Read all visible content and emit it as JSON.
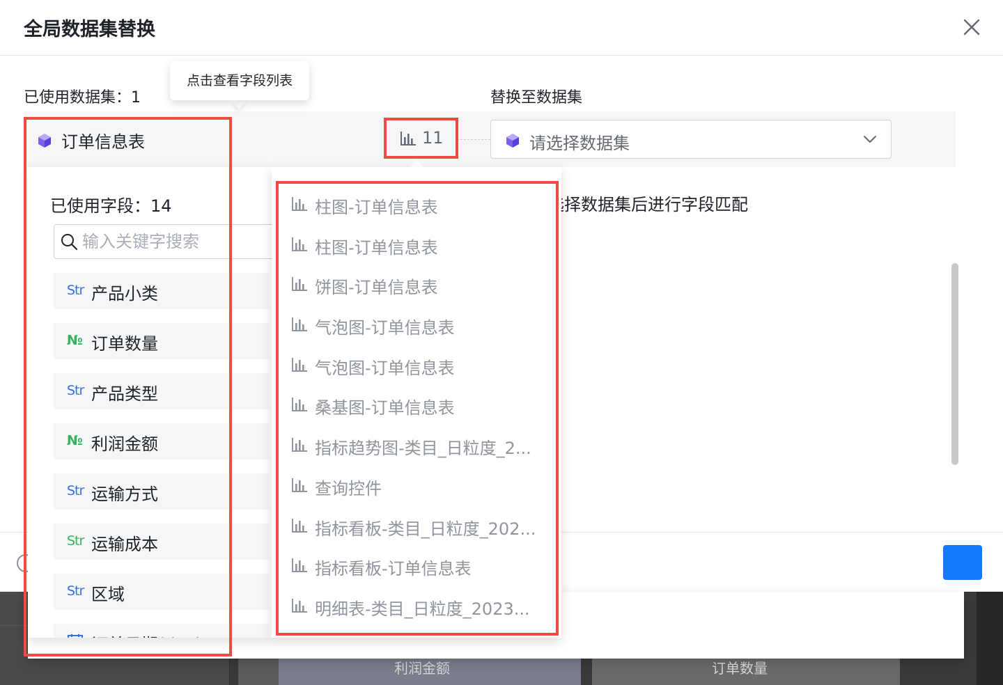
{
  "dialog": {
    "title": "全局数据集替换",
    "close_icon": "close-icon"
  },
  "left_section": {
    "label": "已使用数据集：1",
    "tooltip": "点击查看字段列表"
  },
  "right_section": {
    "label": "替换至数据集"
  },
  "dataset_row": {
    "dataset_icon": "cube-icon",
    "dataset_name": "订单信息表",
    "usage_icon": "bar-chart-icon",
    "usage_count": "11",
    "select_icon": "cube-icon",
    "select_placeholder": "请选择数据集",
    "select_chevron": "chevron-down-icon"
  },
  "match_hint": "选择数据集后进行字段匹配",
  "field_panel": {
    "title": "已使用字段：14",
    "search_placeholder": "输入关键字搜索",
    "fields": [
      {
        "type": "Str",
        "name": "产品小类"
      },
      {
        "type": "№",
        "name": "订单数量"
      },
      {
        "type": "Str",
        "name": "产品类型"
      },
      {
        "type": "№",
        "name": "利润金额"
      },
      {
        "type": "Str",
        "name": "运输方式"
      },
      {
        "type": "Str",
        "name": "运输成本"
      },
      {
        "type": "Str",
        "name": "区域"
      },
      {
        "type": "date",
        "name": "订单日期(day)"
      }
    ]
  },
  "chart_panel": {
    "items": [
      {
        "name": "柱图-订单信息表"
      },
      {
        "name": "柱图-订单信息表"
      },
      {
        "name": "饼图-订单信息表"
      },
      {
        "name": "气泡图-订单信息表"
      },
      {
        "name": "气泡图-订单信息表"
      },
      {
        "name": "桑基图-订单信息表"
      },
      {
        "name": "指标趋势图-类目_日粒度_2..."
      },
      {
        "name": "查询控件"
      },
      {
        "name": "指标看板-类目_日粒度_202..."
      },
      {
        "name": "指标看板-订单信息表"
      },
      {
        "name": "明细表-类目_日粒度_2023..."
      }
    ]
  },
  "background": {
    "col1_label": "利润金额",
    "col2_label": "订单数量"
  },
  "colors": {
    "annotation": "#ef4b40",
    "primary": "#1677ff",
    "str_type": "#3a6fd8",
    "num_type": "#38b25a",
    "muted_text": "#8f959e"
  }
}
